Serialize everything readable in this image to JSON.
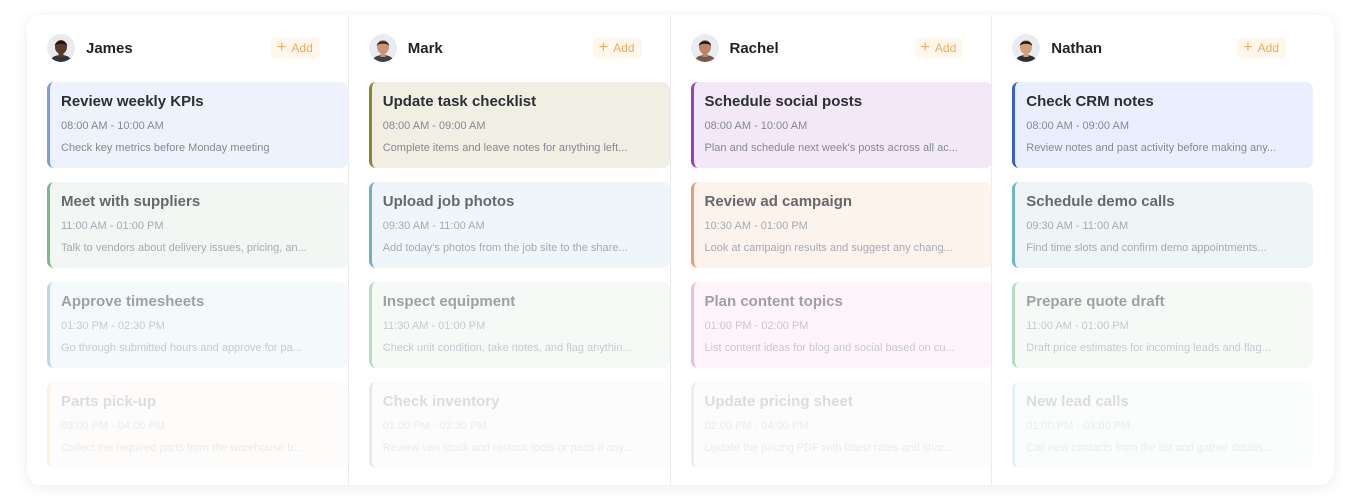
{
  "columns": [
    {
      "name": "James",
      "add_label": "Add",
      "avatar": {
        "skin": "#5a3a2a",
        "hair": "#1a1212",
        "shirt": "#2e3440"
      },
      "cards": [
        {
          "title": "Review weekly KPIs",
          "time": "08:00 AM - 10:00 AM",
          "desc": "Check key metrics before Monday meeting",
          "bg": "#edf2fd",
          "accent": "#7f9ddc"
        },
        {
          "title": "Meet with suppliers",
          "time": "11:00 AM - 01:00 PM",
          "desc": "Talk to vendors about delivery issues, pricing, an...",
          "bg": "#eef5ef",
          "accent": "#4f9a68"
        },
        {
          "title": "Approve timesheets",
          "time": "01:30 PM - 02:30 PM",
          "desc": "Go through submitted hours and approve for pa...",
          "bg": "#e8f3f8",
          "accent": "#62a8c8"
        },
        {
          "title": "Parts pick-up",
          "time": "03:00 PM - 04:00 PM",
          "desc": "Collect the required parts from the warehouse b...",
          "bg": "#fdf1e2",
          "accent": "#eda459"
        }
      ]
    },
    {
      "name": "Mark",
      "add_label": "Add",
      "avatar": {
        "skin": "#c9967a",
        "hair": "#3a2a22",
        "shirt": "#3c4450"
      },
      "cards": [
        {
          "title": "Update task checklist",
          "time": "08:00 AM - 09:00 AM",
          "desc": "Complete items and leave notes for anything left...",
          "bg": "#f1efe3",
          "accent": "#8c8530"
        },
        {
          "title": "Upload job photos",
          "time": "09:30 AM - 11:00 AM",
          "desc": "Add today's photos from the job site to the share...",
          "bg": "#eaf3f7",
          "accent": "#3b93ad"
        },
        {
          "title": "Inspect equipment",
          "time": "11:30 AM - 01:00 PM",
          "desc": "Check unit condition, take notes, and flag anythin...",
          "bg": "#eaf4ed",
          "accent": "#62b07c"
        },
        {
          "title": "Check inventory",
          "time": "01:00 PM - 02:30 PM",
          "desc": "Review van stock and restock tools or parts if any...",
          "bg": "#e7f2ec",
          "accent": "#4e9a74"
        }
      ]
    },
    {
      "name": "Rachel",
      "add_label": "Add",
      "avatar": {
        "skin": "#b98467",
        "hair": "#1f1410",
        "shirt": "#7a5a4a"
      },
      "cards": [
        {
          "title": "Schedule social posts",
          "time": "08:00 AM - 10:00 AM",
          "desc": "Plan and schedule next week's posts across all ac...",
          "bg": "#f3e8f8",
          "accent": "#9b3fc0"
        },
        {
          "title": "Review ad campaign",
          "time": "10:30 AM - 01:00 PM",
          "desc": "Look at campaign results and suggest any chang...",
          "bg": "#fcefe7",
          "accent": "#dd7a47"
        },
        {
          "title": "Plan content topics",
          "time": "01:00 PM - 02:00 PM",
          "desc": "List content ideas for blog and social based on cu...",
          "bg": "#fce9f2",
          "accent": "#e36aa3"
        },
        {
          "title": "Update pricing sheet",
          "time": "02:00 PM - 04:00 PM",
          "desc": "Update the pricing PDF with latest rates and shar...",
          "bg": "#edf1f6",
          "accent": "#7f95b0"
        }
      ]
    },
    {
      "name": "Nathan",
      "add_label": "Add",
      "avatar": {
        "skin": "#d0a07c",
        "hair": "#1d1714",
        "shirt": "#2b2f38"
      },
      "cards": [
        {
          "title": "Check CRM notes",
          "time": "08:00 AM - 09:00 AM",
          "desc": "Review notes and past activity before making any...",
          "bg": "#eaeffd",
          "accent": "#3a5fc8"
        },
        {
          "title": "Schedule demo calls",
          "time": "09:30 AM - 11:00 AM",
          "desc": "Find time slots and confirm demo appointments...",
          "bg": "#e8f2f4",
          "accent": "#3a9aaa"
        },
        {
          "title": "Prepare quote draft",
          "time": "11:00 AM - 01:00 PM",
          "desc": "Draft price estimates for incoming leads and flag...",
          "bg": "#ebf5ee",
          "accent": "#5cae78"
        },
        {
          "title": "New lead calls",
          "time": "01:00 PM - 03:00 PM",
          "desc": "Call new contacts from the list and gather details...",
          "bg": "#e8f3f6",
          "accent": "#5fa8bd"
        }
      ]
    }
  ]
}
